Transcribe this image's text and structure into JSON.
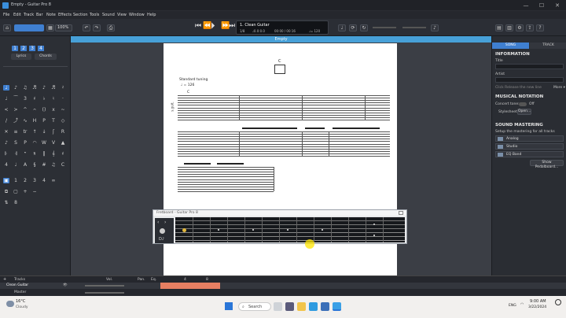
{
  "window": {
    "title": "Empty - Guitar Pro 8",
    "minimize": "—",
    "maximize": "☐",
    "close": "✕"
  },
  "menu": [
    "File",
    "Edit",
    "Track",
    "Bar",
    "Note",
    "Effects",
    "Section",
    "Tools",
    "Sound",
    "View",
    "Window",
    "Help"
  ],
  "toolbar": {
    "zoom": "100%",
    "undo": "↶",
    "redo": "↷"
  },
  "transport": {
    "track_name": "1. Clean Guitar",
    "bar_pos": "1/8",
    "beat": "♩0.0:0.0",
    "time": "00:00 / 00:16",
    "tempo_label": "♩= 120",
    "tempo_value": "120"
  },
  "document": {
    "tab_title": "Empty",
    "tuning": "Standard tuning",
    "tempo_mark": "♩ = 126",
    "chord": "C",
    "instrument": "s.guit."
  },
  "left_panel": {
    "lyrics": "Lyrics",
    "chords": "Chords",
    "pages": [
      "1",
      "2",
      "3",
      "4"
    ]
  },
  "fretboard": {
    "title": "Fretboard - Guitar Pro 8"
  },
  "right_panel": {
    "tabs": {
      "song": "SONG",
      "track": "TRACK"
    },
    "information": "INFORMATION",
    "title_label": "Title",
    "artist_label": "Artist",
    "click_hint": "Click Release the new line",
    "more": "More ▾",
    "musical_notation": "MUSICAL NOTATION",
    "concert_tone": "Concert tone:",
    "concert_state": "Off",
    "stylesheet": "Stylesheet:",
    "open": "Open...",
    "sound_mastering": "SOUND MASTERING",
    "mastering_desc": "Setup the mastering for all tracks",
    "mastering_rows": [
      "Analog",
      "Studio",
      "EQ Band"
    ],
    "show_pedalboard": "Show Pedalboard..."
  },
  "tracks": {
    "header": "Tracks",
    "vol": "Vol.",
    "pan": "Pan.",
    "eq": "Eq.",
    "track1": "Clean Guitar",
    "master": "Master",
    "bar_marker": "4",
    "bar_marker2": "8"
  },
  "taskbar": {
    "weather_temp": "16°C",
    "weather_desc": "Cloudy",
    "search": "Search",
    "lang": "ENG",
    "time": "9:00 AM",
    "date": "3/22/2024"
  }
}
